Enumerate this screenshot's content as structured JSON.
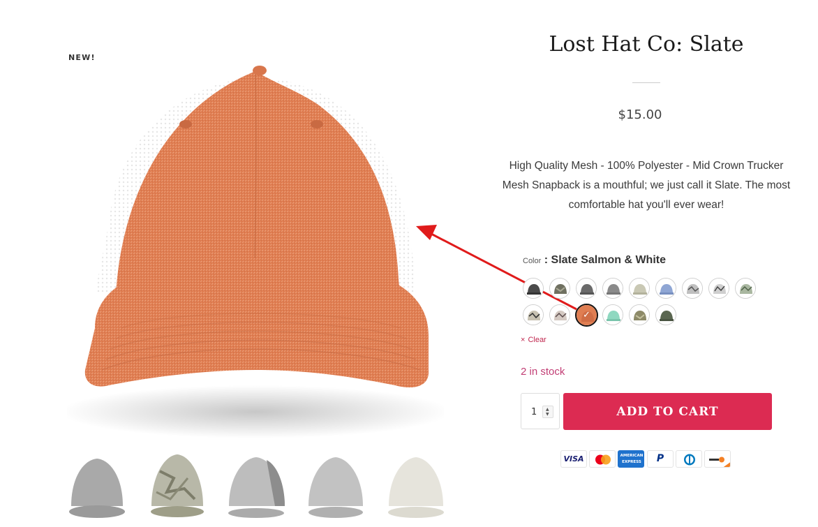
{
  "badge": {
    "new": "NEW!"
  },
  "product": {
    "title": "Lost Hat Co: Slate",
    "price": "$15.00",
    "description": "High Quality Mesh - 100% Polyester - Mid Crown Trucker Mesh Snapback is a mouthful; we just call it Slate. The most comfortable hat you'll ever wear!"
  },
  "variant": {
    "label": "Color",
    "separator": ":",
    "selected": "Slate Salmon & White",
    "clear_label": "Clear",
    "clear_icon": "×",
    "selected_check": "✓",
    "swatch_count": 17,
    "selected_index": 11
  },
  "stock": {
    "text": "2 in stock"
  },
  "quantity": {
    "value": "1",
    "up": "▲",
    "down": "▼"
  },
  "cart": {
    "add_label": "ADD TO CART"
  },
  "payments": {
    "visa": "VISA",
    "mastercard": "mastercard-icon",
    "amex": "AMERICAN EXPRESS",
    "paypal": "P",
    "diners": "diners-club-icon",
    "discover": "discover-icon"
  },
  "colors": {
    "accent": "#dc2b52",
    "stock": "#c13d74",
    "hat_main": "#e07e52",
    "hat_mesh": "#ffffff"
  }
}
